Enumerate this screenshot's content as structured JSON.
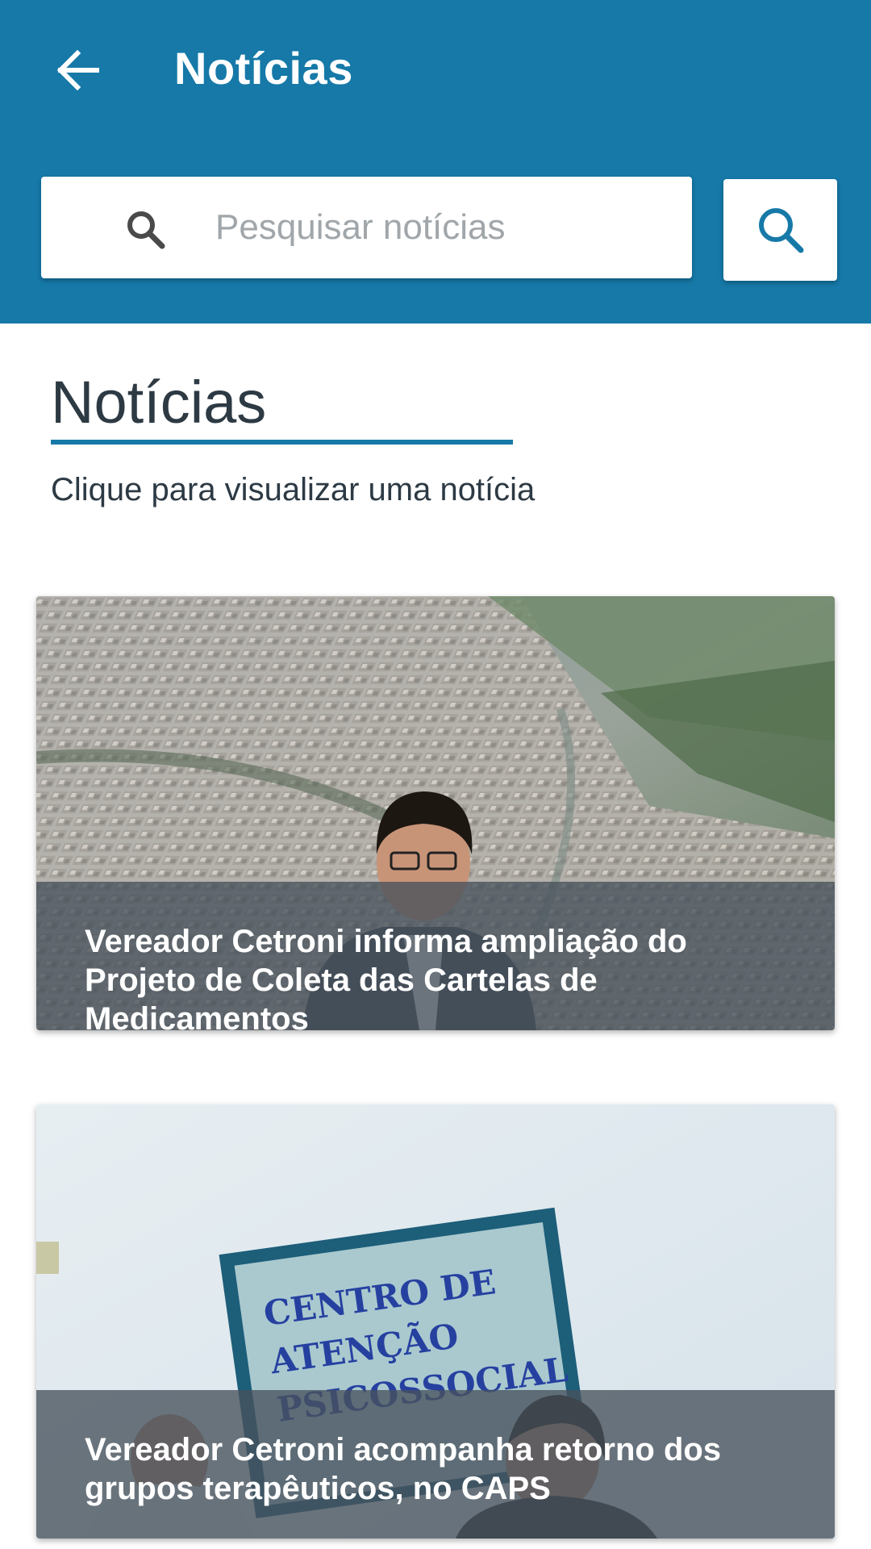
{
  "header": {
    "back_icon": "arrow-left-icon",
    "title": "Notícias",
    "background_color": "#1679a8"
  },
  "search": {
    "placeholder": "Pesquisar notícias",
    "value": "",
    "leading_icon": "search-icon",
    "button_icon": "search-icon"
  },
  "section": {
    "title": "Notícias",
    "subtitle": "Clique para visualizar uma notícia"
  },
  "news": [
    {
      "title": "Vereador Cetroni informa ampliação do Projeto de Coleta das Cartelas de Medicamentos",
      "image": "aerial-city-photo"
    },
    {
      "title": "Vereador Cetroni acompanha retorno dos grupos terapêuticos, no CAPS",
      "image": "caps-sign-photo",
      "sign_text": "CENTRO DE ATENÇÃO PSICOSSOCIAL"
    }
  ]
}
